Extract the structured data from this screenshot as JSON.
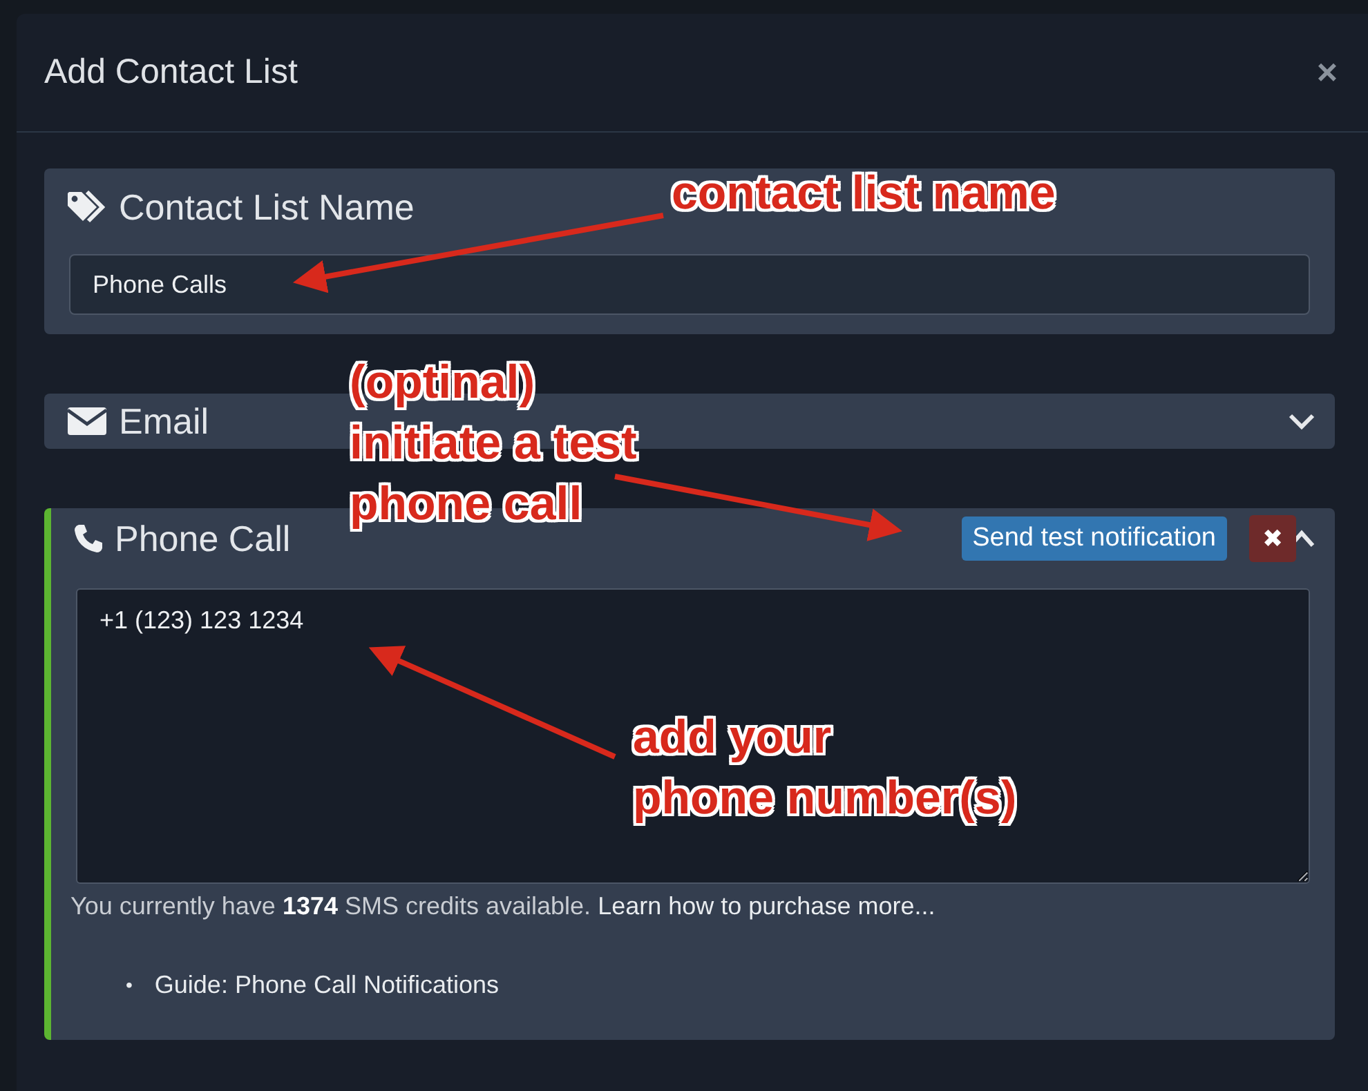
{
  "modal": {
    "title": "Add Contact List",
    "close": "×"
  },
  "sections": [
    {
      "kind": "name",
      "title": "Contact List Name",
      "value": "Phone Calls"
    },
    {
      "kind": "channel",
      "title": "Email",
      "expanded": false,
      "active": false
    },
    {
      "kind": "phone",
      "title": "Phone Call",
      "expanded": true,
      "active": true,
      "test_button": "Send test notification",
      "delete": "✖",
      "numbers": "+1 (123) 123 1234",
      "credits": "You currently have **1374** SMS credits available.",
      "credits_link": "Learn how to purchase more...",
      "guides": [
        {
          "bullet": "•",
          "text": "Guide: Phone Call Notifications"
        }
      ]
    }
  ],
  "annotations": [
    {
      "text": "contact list name"
    },
    {
      "text": "(optinal)\ninitiate a test\nphone call"
    },
    {
      "text": "add your\nphone number(s)"
    }
  ]
}
